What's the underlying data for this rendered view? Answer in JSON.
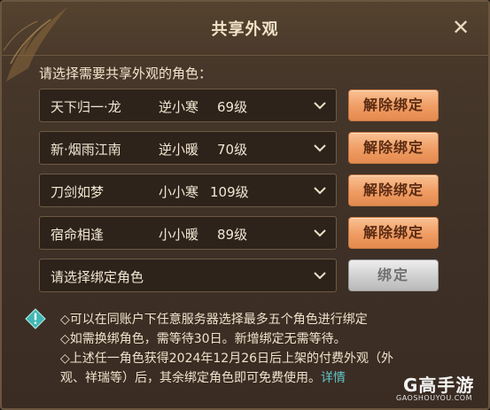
{
  "dialog": {
    "title": "共享外观",
    "prompt": "请选择需要共享外观的角色：",
    "close_icon": "close-icon"
  },
  "rows": [
    {
      "name": "天下归一·龙",
      "server": "逆小寒",
      "level": "69级",
      "button": "解除绑定"
    },
    {
      "name": "新·烟雨江南",
      "server": "逆小暖",
      "level": "70级",
      "button": "解除绑定"
    },
    {
      "name": "刀剑如梦",
      "server": "小小寒",
      "level": "109级",
      "button": "解除绑定"
    },
    {
      "name": "宿命相逢",
      "server": "小小暖",
      "level": "89级",
      "button": "解除绑定"
    }
  ],
  "empty_row": {
    "placeholder": "请选择绑定角色",
    "button": "绑定"
  },
  "notes": [
    "◇可以在同账户下任意服务器选择最多五个角色进行绑定",
    "◇如需换绑角色，需等待30日。新增绑定无需等待。",
    "◇上述任一角色获得2024年12月26日后上架的付费外观（外",
    "观、祥瑞等）后，其余绑定角色即可免费使用。"
  ],
  "details_link": "详情",
  "watermark": {
    "brand": "G高手游",
    "url": "GAOSHOUYOU.COM"
  },
  "colors": {
    "panel": "#3e3026",
    "unbind_button": "#ef9c63",
    "bind_button_disabled": "#cfcfcf",
    "info_icon": "#3fb7b5",
    "link": "#5fc5c9"
  }
}
